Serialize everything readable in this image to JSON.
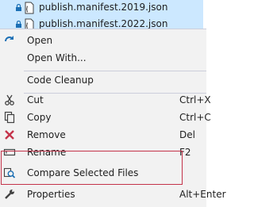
{
  "files": [
    {
      "name": "publish.manifest.2019.json"
    },
    {
      "name": "publish.manifest.2022.json"
    }
  ],
  "menu": {
    "items": {
      "open": {
        "label": "Open",
        "shortcut": ""
      },
      "open_with": {
        "label": "Open With...",
        "shortcut": ""
      },
      "code_cleanup": {
        "label": "Code Cleanup",
        "shortcut": ""
      },
      "cut": {
        "label": "Cut",
        "shortcut": "Ctrl+X"
      },
      "copy": {
        "label": "Copy",
        "shortcut": "Ctrl+C"
      },
      "remove": {
        "label": "Remove",
        "shortcut": "Del"
      },
      "rename": {
        "label": "Rename",
        "shortcut": "F2"
      },
      "compare": {
        "label": "Compare Selected Files",
        "shortcut": ""
      },
      "properties": {
        "label": "Properties",
        "shortcut": "Alt+Enter"
      }
    }
  },
  "colors": {
    "selection": "#cce8ff",
    "menu_bg": "#f2f2f2",
    "highlight_border": "#c4334a",
    "remove_icon": "#c4334a",
    "compare_icon": "#1b6fb5"
  },
  "icons": {
    "open": "open-arrow-icon",
    "cut": "scissors-icon",
    "copy": "copy-icon",
    "remove": "remove-x-icon",
    "rename": "rename-icon",
    "compare": "compare-icon",
    "properties": "wrench-icon"
  }
}
